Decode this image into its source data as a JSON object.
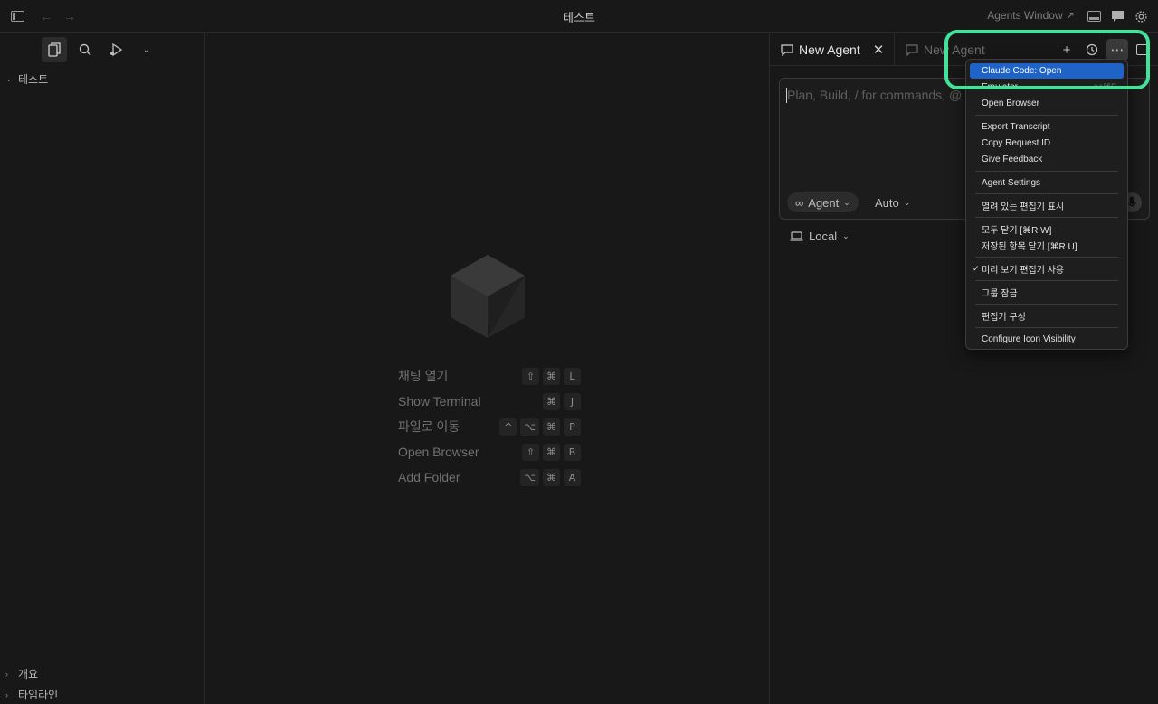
{
  "window": {
    "title": "테스트",
    "agents_window_label": "Agents Window ↗"
  },
  "sidebar": {
    "root_folder": "테스트",
    "bottom_sections": [
      {
        "label": "개요"
      },
      {
        "label": "타임라인"
      }
    ]
  },
  "editor": {
    "shortcuts": [
      {
        "label": "채팅 열기",
        "keys": [
          "⇧",
          "⌘",
          "L"
        ]
      },
      {
        "label": "Show Terminal",
        "keys": [
          "⌘",
          "J"
        ]
      },
      {
        "label": "파일로 이동",
        "keys": [
          "^",
          "⌥",
          "⌘",
          "P"
        ]
      },
      {
        "label": "Open Browser",
        "keys": [
          "⇧",
          "⌘",
          "B"
        ]
      },
      {
        "label": "Add Folder",
        "keys": [
          "⌥",
          "⌘",
          "A"
        ]
      }
    ]
  },
  "agent_panel": {
    "tabs": [
      {
        "label": "New Agent",
        "close": "✕"
      },
      {
        "label": "New Agent"
      }
    ],
    "prompt_placeholder": "Plan, Build, / for commands, @",
    "agent_mode": "Agent",
    "model": "Auto",
    "environment": "Local"
  },
  "menu": {
    "items": [
      {
        "label": "Claude Code: Open",
        "highlight": true
      },
      {
        "label": "Emulator",
        "hint": "⌥⌘E"
      },
      {
        "label": "Open Browser"
      },
      {
        "label": "Export Transcript"
      },
      {
        "label": "Copy Request ID"
      },
      {
        "label": "Give Feedback"
      },
      {
        "label": "Agent Settings"
      },
      {
        "label": "열려 있는 편집기 표시"
      },
      {
        "label": "모두 닫기 [⌘R W]"
      },
      {
        "label": "저장된 항목 닫기 [⌘R U]"
      },
      {
        "label": "미리 보기 편집기 사용",
        "checked": "✓"
      },
      {
        "label": "그룹 잠금"
      },
      {
        "label": "편집기 구성"
      },
      {
        "label": "Configure Icon Visibility"
      }
    ]
  },
  "colors": {
    "accent_highlight": "#1f63c6",
    "annotation": "#43e29a",
    "background": "#181818"
  }
}
